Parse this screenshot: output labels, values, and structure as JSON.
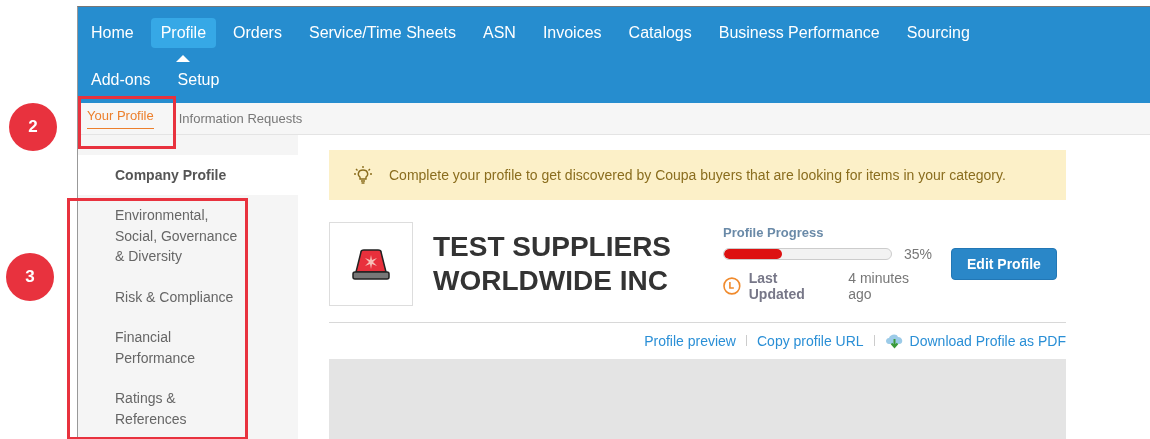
{
  "nav_rows": [
    [
      {
        "label": "Home",
        "selected": false
      },
      {
        "label": "Profile",
        "selected": true
      },
      {
        "label": "Orders",
        "selected": false
      },
      {
        "label": "Service/Time Sheets",
        "selected": false
      },
      {
        "label": "ASN",
        "selected": false
      },
      {
        "label": "Invoices",
        "selected": false
      },
      {
        "label": "Catalogs",
        "selected": false
      },
      {
        "label": "Business Performance",
        "selected": false
      },
      {
        "label": "Sourcing",
        "selected": false
      }
    ],
    [
      {
        "label": "Add-ons",
        "selected": false
      },
      {
        "label": "Setup",
        "selected": false
      }
    ]
  ],
  "subtabs": [
    {
      "label": "Your Profile",
      "selected": true
    },
    {
      "label": "Information Requests",
      "selected": false
    }
  ],
  "sidebar": {
    "items": [
      {
        "label": "Company Profile",
        "selected": true
      },
      {
        "label": "Environmental, Social, Governance & Diversity",
        "selected": false
      },
      {
        "label": "Risk & Compliance",
        "selected": false
      },
      {
        "label": "Financial Performance",
        "selected": false
      },
      {
        "label": "Ratings & References",
        "selected": false
      }
    ]
  },
  "banner": {
    "text": "Complete your profile to get discovered by Coupa buyers that are looking for items in your category."
  },
  "company": {
    "name": "TEST SUPPLIERS WORLDWIDE INC"
  },
  "progress": {
    "label": "Profile Progress",
    "level": 0.35,
    "reading": "35%"
  },
  "last_updated": {
    "label": "Last Updated",
    "value": "4 minutes ago"
  },
  "edit_button": "Edit Profile",
  "links": [
    {
      "label": "Profile preview",
      "kind": "link"
    },
    {
      "label": "Copy profile URL",
      "kind": "link"
    },
    {
      "label": "Download Profile as PDF",
      "kind": "download"
    }
  ],
  "callouts": [
    {
      "label": "2"
    },
    {
      "label": "3"
    }
  ]
}
